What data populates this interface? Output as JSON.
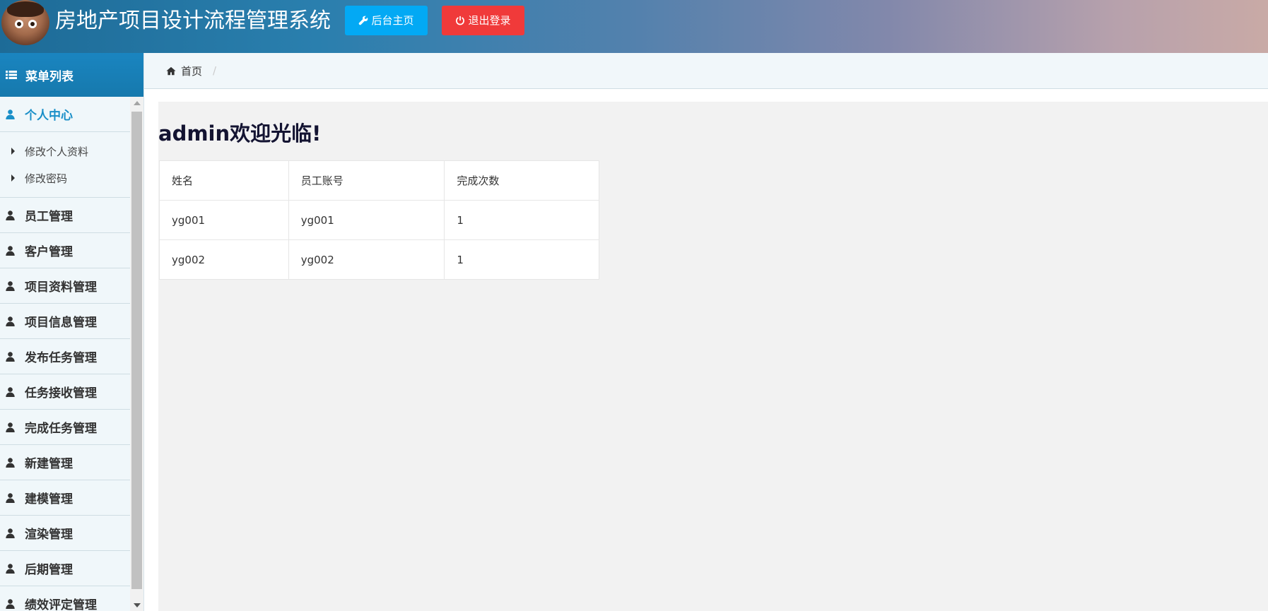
{
  "header": {
    "app_title": "房地产项目设计流程管理系统",
    "home_button": "后台主页",
    "logout_button": "退出登录",
    "colors": {
      "home_button_bg": "#03a9f4",
      "logout_button_bg": "#f03a3a"
    }
  },
  "sidebar": {
    "title": "菜单列表",
    "items": [
      {
        "label": "个人中心",
        "active": true,
        "children": [
          {
            "label": "修改个人资料"
          },
          {
            "label": "修改密码"
          }
        ]
      },
      {
        "label": "员工管理"
      },
      {
        "label": "客户管理"
      },
      {
        "label": "项目资料管理"
      },
      {
        "label": "项目信息管理"
      },
      {
        "label": "发布任务管理"
      },
      {
        "label": "任务接收管理"
      },
      {
        "label": "完成任务管理"
      },
      {
        "label": "新建管理"
      },
      {
        "label": "建模管理"
      },
      {
        "label": "渲染管理"
      },
      {
        "label": "后期管理"
      },
      {
        "label": "绩效评定管理"
      }
    ]
  },
  "breadcrumb": {
    "home": "首页",
    "separator": "/"
  },
  "main": {
    "welcome": "admin欢迎光临!",
    "table": {
      "headers": [
        "姓名",
        "员工账号",
        "完成次数"
      ],
      "rows": [
        [
          "yg001",
          "yg001",
          "1"
        ],
        [
          "yg002",
          "yg002",
          "1"
        ]
      ]
    }
  }
}
